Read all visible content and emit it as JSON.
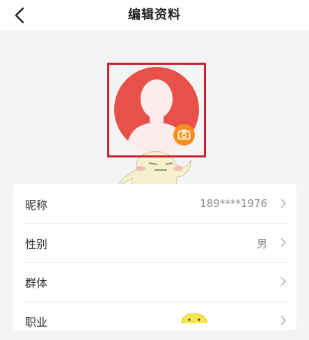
{
  "header": {
    "title": "编辑资料",
    "back_icon": "chevron-left-icon"
  },
  "avatar": {
    "icon": "default-avatar-icon",
    "camera_icon": "camera-icon"
  },
  "profile": {
    "rows": [
      {
        "label": "昵称",
        "value": "189****1976"
      },
      {
        "label": "性别",
        "value": "男"
      },
      {
        "label": "群体",
        "value": ""
      },
      {
        "label": "职业",
        "value": ""
      }
    ]
  },
  "colors": {
    "avatar_bg": "#e8514a",
    "camera_bg": "#f5901e",
    "highlight_border": "#c8232c"
  }
}
